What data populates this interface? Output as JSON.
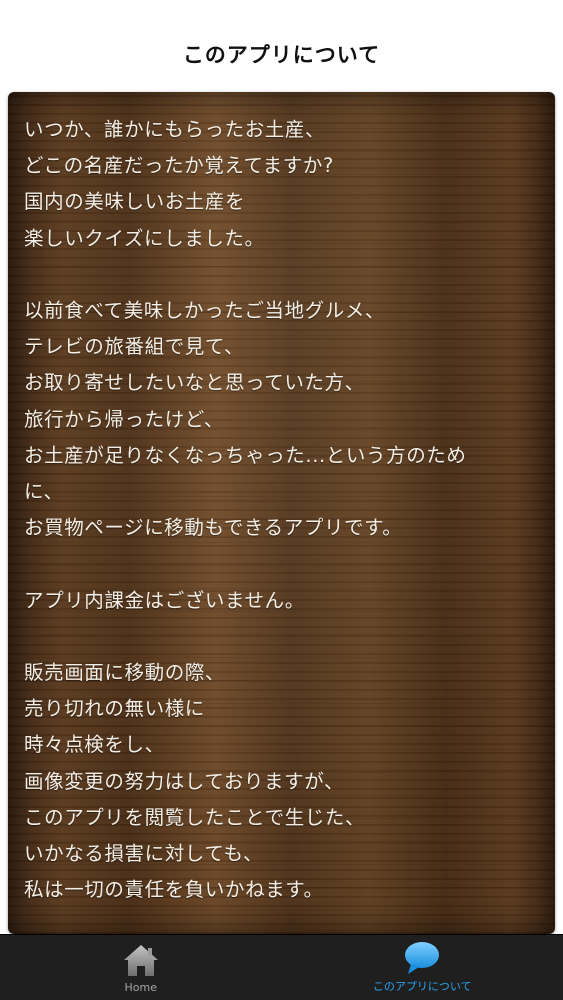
{
  "header": {
    "title": "このアプリについて"
  },
  "content": {
    "paragraphs": [
      {
        "lines": [
          "いつか、誰かにもらったお土産、",
          "どこの名産だったか覚えてますか?",
          "国内の美味しいお土産を",
          "楽しいクイズにしました。"
        ]
      },
      {
        "lines": [
          "以前食べて美味しかったご当地グルメ、",
          "テレビの旅番組で見て、",
          "お取り寄せしたいなと思っていた方、",
          "旅行から帰ったけど、",
          "お土産が足りなくなっちゃった...という方のため",
          "に、",
          "お買物ページに移動もできるアプリです。"
        ]
      },
      {
        "lines": [
          "アプリ内課金はございません。"
        ]
      },
      {
        "lines": [
          "販売画面に移動の際、",
          "売り切れの無い様に",
          "時々点検をし、",
          "画像変更の努力はしておりますが、",
          "このアプリを閲覧したことで生じた、",
          "いかなる損害に対しても、",
          "私は一切の責任を負いかねます。"
        ]
      }
    ]
  },
  "tabbar": {
    "tabs": [
      {
        "label": "Home",
        "icon": "home-icon",
        "active": false
      },
      {
        "label": "このアプリについて",
        "icon": "speech-bubble-icon",
        "active": true
      }
    ]
  },
  "colors": {
    "active_tab": "#2ea3ee",
    "inactive_tab": "#a8a8a8",
    "tabbar_bg": "#1f1f1f",
    "text_on_wood": "#f4efe6"
  }
}
